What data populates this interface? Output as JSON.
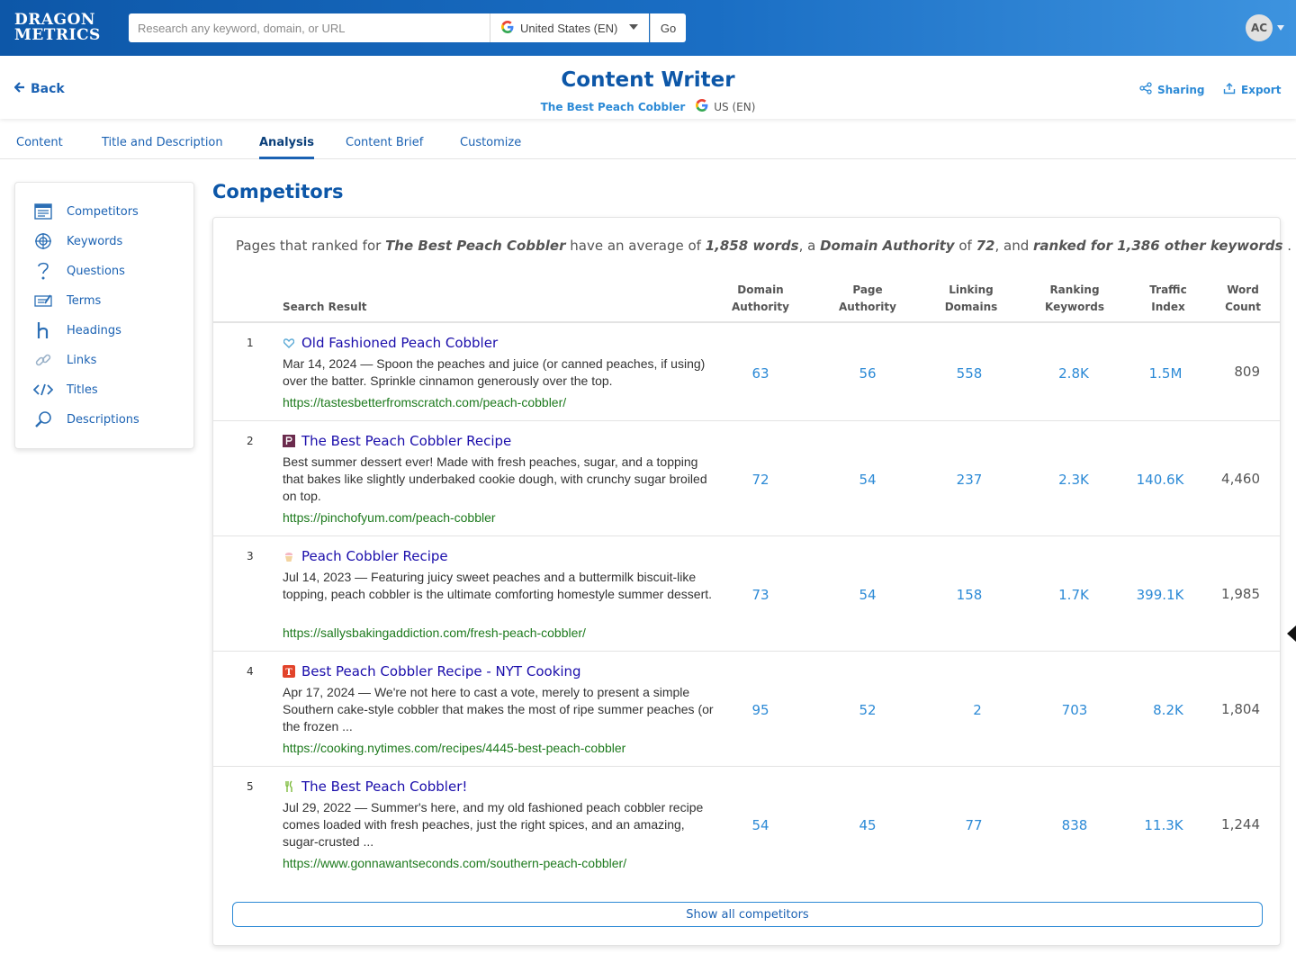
{
  "logo": {
    "line1": "DRAGON",
    "line2": "METRICS"
  },
  "search": {
    "placeholder": "Research any keyword, domain, or URL",
    "country": "United States (EN)",
    "go_label": "Go"
  },
  "user": {
    "initials": "AC"
  },
  "header": {
    "back_label": "Back",
    "title": "Content Writer",
    "keyword": "The Best Peach Cobbler",
    "locale": "US (EN)",
    "sharing_label": "Sharing",
    "export_label": "Export"
  },
  "tabs": [
    {
      "label": "Content"
    },
    {
      "label": "Title and Description"
    },
    {
      "label": "Analysis"
    },
    {
      "label": "Content Brief"
    },
    {
      "label": "Customize"
    }
  ],
  "sidebar": {
    "items": [
      {
        "label": "Competitors",
        "icon": "list-icon"
      },
      {
        "label": "Keywords",
        "icon": "target-icon"
      },
      {
        "label": "Questions",
        "icon": "question-icon"
      },
      {
        "label": "Terms",
        "icon": "terms-icon"
      },
      {
        "label": "Headings",
        "icon": "heading-icon"
      },
      {
        "label": "Links",
        "icon": "link-icon"
      },
      {
        "label": "Titles",
        "icon": "code-icon"
      },
      {
        "label": "Descriptions",
        "icon": "magnifier-icon"
      }
    ]
  },
  "main": {
    "section_title": "Competitors",
    "summary": {
      "pre": "Pages that ranked for ",
      "keyword": "The Best Peach Cobbler",
      "mid1": " have an average of ",
      "words": "1,858 words",
      "mid2": ", a ",
      "da_label": "Domain Authority",
      "mid3": " of ",
      "da_value": "72",
      "mid4": ", and ",
      "ranked": "ranked for 1,386 other keywords",
      "end": " ."
    },
    "columns": {
      "search_result": "Search Result",
      "domain_authority": [
        "Domain",
        "Authority"
      ],
      "page_authority": [
        "Page",
        "Authority"
      ],
      "linking_domains": [
        "Linking",
        "Domains"
      ],
      "ranking_keywords": [
        "Ranking",
        "Keywords"
      ],
      "traffic_index": [
        "Traffic",
        "Index"
      ],
      "word_count": [
        "Word",
        "Count"
      ]
    },
    "rows": [
      {
        "rank": "1",
        "title": "Old Fashioned Peach Cobbler",
        "favicon": "heart-icon",
        "desc": "Mar 14, 2024 — Spoon the peaches and juice (or canned peaches, if using) over the batter. Sprinkle cinnamon generously over the top.",
        "url": "https://tastesbetterfromscratch.com/peach-cobbler/",
        "da": "63",
        "pa": "56",
        "ld": "558",
        "rk": "2.8K",
        "ti": "1.5M",
        "wc": "809"
      },
      {
        "rank": "2",
        "title": "The Best Peach Cobbler Recipe",
        "favicon": "p-square-icon",
        "desc": "Best summer dessert ever! Made with fresh peaches, sugar, and a topping that bakes like slightly underbaked cookie dough, with crunchy sugar broiled on top.",
        "url": "https://pinchofyum.com/peach-cobbler",
        "da": "72",
        "pa": "54",
        "ld": "237",
        "rk": "2.3K",
        "ti": "140.6K",
        "wc": "4,460"
      },
      {
        "rank": "3",
        "title": "Peach Cobbler Recipe",
        "favicon": "cupcake-icon",
        "desc": "Jul 14, 2023 — Featuring juicy sweet peaches and a buttermilk biscuit-like topping, peach cobbler is the ultimate comforting homestyle summer dessert.",
        "url": "https://sallysbakingaddiction.com/fresh-peach-cobbler/",
        "da": "73",
        "pa": "54",
        "ld": "158",
        "rk": "1.7K",
        "ti": "399.1K",
        "wc": "1,985"
      },
      {
        "rank": "4",
        "title": "Best Peach Cobbler Recipe - NYT Cooking",
        "favicon": "nyt-icon",
        "desc": "Apr 17, 2024 — We're not here to cast a vote, merely to present a simple Southern cake-style cobbler that makes the most of ripe summer peaches (or the frozen ...",
        "url": "https://cooking.nytimes.com/recipes/4445-best-peach-cobbler",
        "da": "95",
        "pa": "52",
        "ld": "2",
        "rk": "703",
        "ti": "8.2K",
        "wc": "1,804"
      },
      {
        "rank": "5",
        "title": "The Best Peach Cobbler!",
        "favicon": "fork-icon",
        "desc": "Jul 29, 2022 — Summer's here, and my old fashioned peach cobbler recipe comes loaded with fresh peaches, just the right spices, and an amazing, sugar-crusted ...",
        "url": "https://www.gonnawantseconds.com/southern-peach-cobbler/",
        "da": "54",
        "pa": "45",
        "ld": "77",
        "rk": "838",
        "ti": "11.3K",
        "wc": "1,244"
      }
    ],
    "show_all_label": "Show all competitors"
  },
  "colors": {
    "brand_blue": "#0d57a8",
    "link_blue": "#2c8ad6",
    "result_title": "#1a0dab",
    "url_green": "#1d7a1d"
  }
}
